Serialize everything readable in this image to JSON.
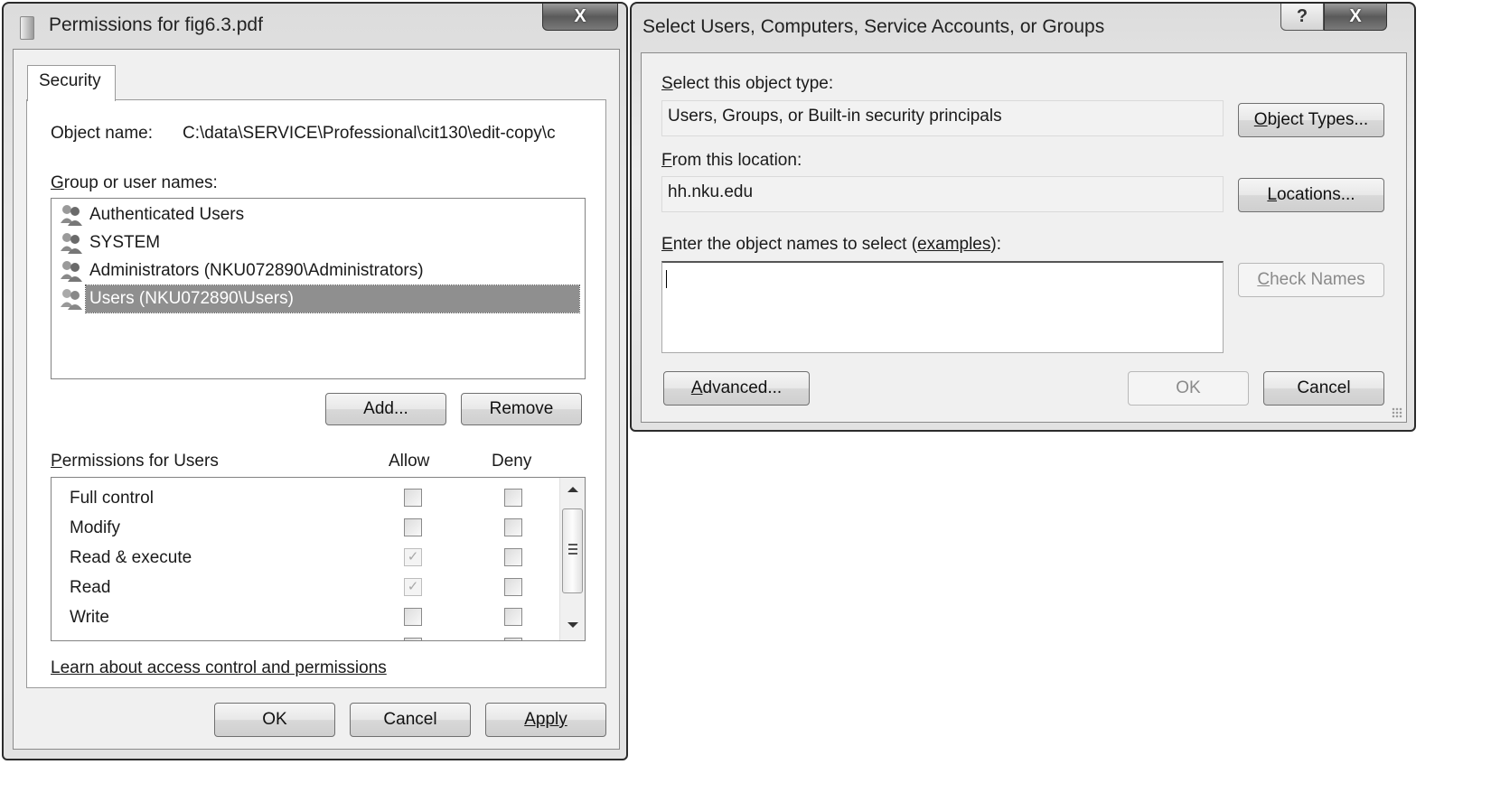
{
  "permissions_dialog": {
    "title": "Permissions for fig6.3.pdf",
    "close_label": "X",
    "tab_label": "Security",
    "object_name_label": "Object name:",
    "object_name_value": "C:\\data\\SERVICE\\Professional\\cit130\\edit-copy\\c",
    "group_label": "Group or user names:",
    "groups": [
      {
        "name": "Authenticated Users",
        "selected": false
      },
      {
        "name": "SYSTEM",
        "selected": false
      },
      {
        "name": "Administrators (NKU072890\\Administrators)",
        "selected": false
      },
      {
        "name": "Users (NKU072890\\Users)",
        "selected": true
      }
    ],
    "add_label": "Add...",
    "remove_label": "Remove",
    "permissions_label": "Permissions for Users",
    "allow_header": "Allow",
    "deny_header": "Deny",
    "permissions": [
      {
        "name": "Full control",
        "allow": false,
        "allow_inherited": false,
        "deny": false
      },
      {
        "name": "Modify",
        "allow": false,
        "allow_inherited": false,
        "deny": false
      },
      {
        "name": "Read & execute",
        "allow": true,
        "allow_inherited": true,
        "deny": false
      },
      {
        "name": "Read",
        "allow": true,
        "allow_inherited": true,
        "deny": false
      },
      {
        "name": "Write",
        "allow": false,
        "allow_inherited": false,
        "deny": false
      }
    ],
    "learn_link": "Learn about access control and permissions",
    "ok_label": "OK",
    "cancel_label": "Cancel",
    "apply_label": "Apply"
  },
  "select_dialog": {
    "title": "Select Users, Computers, Service Accounts, or Groups",
    "help_label": "?",
    "close_label": "X",
    "object_type_label": "Select this object type:",
    "object_type_value": "Users, Groups, or Built-in security principals",
    "object_types_button": "Object Types...",
    "location_label": "From this location:",
    "location_value": "hh.nku.edu",
    "locations_button": "Locations...",
    "enter_names_label_prefix": "Enter the object names to select (",
    "examples_link": "examples",
    "enter_names_label_suffix": "):",
    "names_value": "",
    "check_names_button": "Check Names",
    "advanced_button": "Advanced...",
    "ok_label": "OK",
    "cancel_label": "Cancel"
  }
}
